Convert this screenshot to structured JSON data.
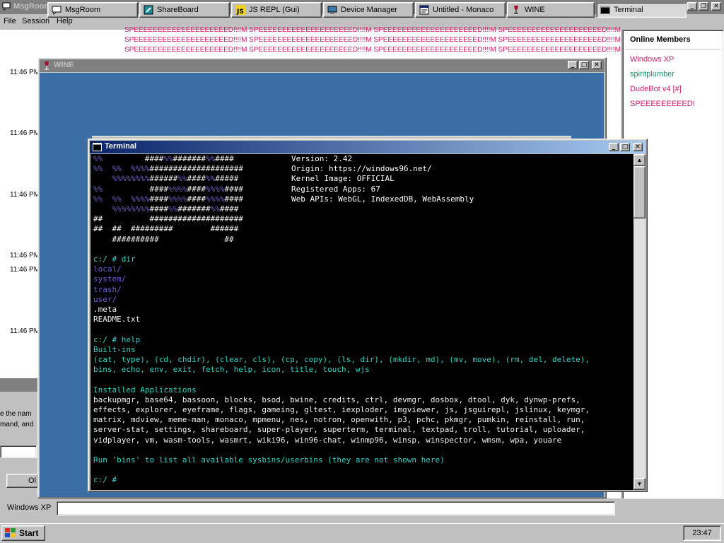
{
  "msgroom": {
    "title": "MsgRoom",
    "menu": [
      "File",
      "Session",
      "Help"
    ],
    "timestamps": [
      "11:46 PM",
      "11:46 PM",
      "11:46 PM",
      "11:46 PM",
      "11:46 PM",
      "11:46 PM"
    ],
    "spam_lines": [
      "SPEEEEEEEEEEEEEEEEEEEED!!!!M SPEEEEEEEEEEEEEEEEEEEED!!!!M SPEEEEEEEEEEEEEEEEEEEED!!!!M SPEEEEEEEEEEEEEEEEEEEED!!!!M",
      "SPEEEEEEEEEEEEEEEEEEEED!!!!M SPEEEEEEEEEEEEEEEEEEEED!!!!M SPEEEEEEEEEEEEEEEEEEEED!!!!M SPEEEEEEEEEEEEEEEEEEEED!!!!M",
      "SPEEEEEEEEEEEEEEEEEEEED!!!!M SPEEEEEEEEEEEEEEEEEEEED!!!!M SPEEEEEEEEEEEEEEEEEEEED!!!!M SPEEEEEEEEEEEEEEEEEEEED!!!!M"
    ],
    "members_title": "Online Members",
    "members": [
      {
        "name": "Windows XP",
        "color": "#d0206a"
      },
      {
        "name": "spiritplumber",
        "color": "#0a9a6e"
      },
      {
        "name": "DudeBot v4 [#]",
        "color": "#d0206a"
      },
      {
        "name": "SPEEEEEEEEED!",
        "color": "#d0206a"
      }
    ],
    "input_label": "Windows XP",
    "dialog_fragment": {
      "line1": "e the nam",
      "line2": "mand, and",
      "button": "Ol"
    }
  },
  "wine": {
    "title": "WINE"
  },
  "terminal": {
    "title": "Terminal",
    "info": [
      "Version: 2.42",
      "Origin: https://windows96.net/",
      "Kernel Image: OFFICIAL",
      "Registered Apps: 67",
      "Web APIs: WebGL, IndexedDB, WebAssembly"
    ],
    "prompt_dir": "c:/ # dir",
    "dir_entries": [
      "local/",
      "system/",
      "trash/",
      "user/"
    ],
    "files": [
      ".meta",
      "README.txt"
    ],
    "prompt_help": "c:/ # help",
    "builtins_title": "Built-ins",
    "builtins_lines": [
      "(cat, type), (cd, chdir), (clear, cls), (cp, copy), (ls, dir), (mkdir, md), (mv, move), (rm, del, delete),",
      "bins, echo, env, exit, fetch, help, icon, title, touch, wjs"
    ],
    "apps_title": "Installed Applications",
    "apps_lines": [
      "backupmgr, base64, bassoon, blocks, bsod, bwine, credits, ctrl, devmgr, dosbox, dtool, dyk, dynwp-prefs,",
      "effects, explorer, eyeframe, flags, gameing, gltest, iexploder, imgviewer, js, jsguirepl, jslinux, keymgr,",
      "matrix, mdview, meme-man, monaco, mpmenu, nes, notron, openwith, p3, pchc, pkmgr, pumkin, reinstall, run,",
      "server-stat, settings, shareboard, super-player, superterm, terminal, textpad, troll, tutorial, uploader,",
      "vidplayer, vm, wasm-tools, wasmrt, wiki96, win96-chat, winmp96, winsp, winspector, wmsm, wpa, youare"
    ],
    "bins_note": "Run 'bins' to list all available sysbins/userbins (they are not shown here)",
    "final_prompt": "c:/ #"
  },
  "taskbar": {
    "start": "Start",
    "tasks": [
      {
        "label": "MsgRoom",
        "icon": "chat-icon"
      },
      {
        "label": "ShareBoard",
        "icon": "board-icon"
      },
      {
        "label": "JS REPL (Gui)",
        "icon": "js-icon"
      },
      {
        "label": "Device Manager",
        "icon": "device-icon"
      },
      {
        "label": "Untitled - Monaco",
        "icon": "editor-icon"
      },
      {
        "label": "WINE",
        "icon": "wine-icon"
      },
      {
        "label": "Terminal",
        "icon": "terminal-icon"
      }
    ],
    "clock": "23:47"
  },
  "colors": {
    "terminal_cyan": "#2ed3c6",
    "terminal_blue": "#6a5ed8",
    "wine_desktop": "#3a6ea5",
    "spam_pink": "#d0206a"
  }
}
